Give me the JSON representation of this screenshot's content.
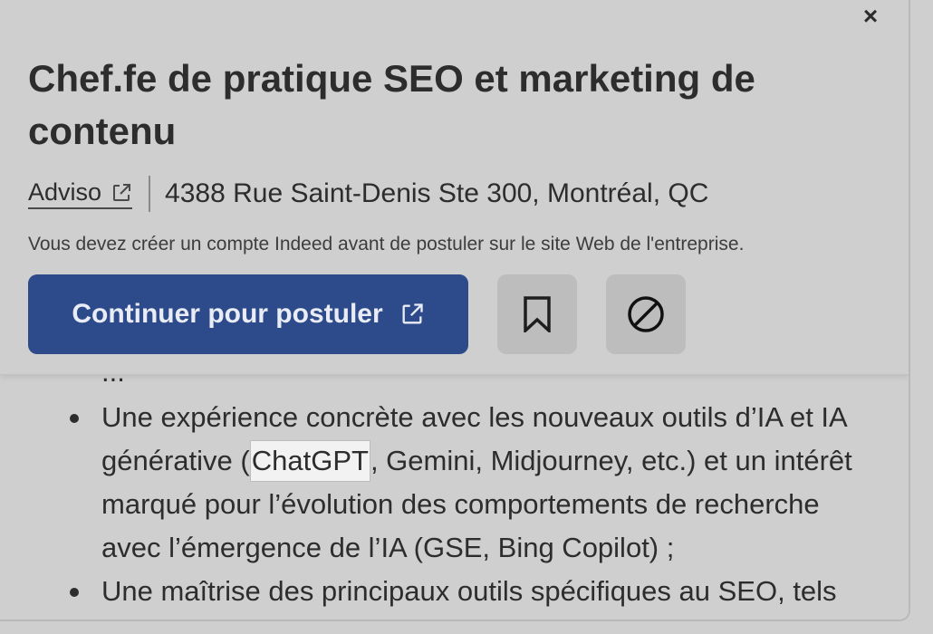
{
  "close_label": "×",
  "job": {
    "title": "Chef.fe de pratique SEO et marketing de contenu",
    "company": "Adviso",
    "location": "4388 Rue Saint-Denis Ste 300, Montréal, QC",
    "notice": "Vous devez créer un compte Indeed avant de postuler sur le site Web de l'entreprise.",
    "apply_label": "Continuer pour postuler"
  },
  "icons": {
    "external": "external-link-icon",
    "save": "bookmark-icon",
    "block": "not-interested-icon",
    "close": "close-icon"
  },
  "colors": {
    "accent": "#2d4a8b",
    "background": "#cfcfcf",
    "text": "#2d2d2d"
  },
  "description": {
    "partial_line": "...",
    "items": [
      {
        "before": "Une expérience concrète avec les nouveaux outils d’IA et IA générative (",
        "highlight": "ChatGPT",
        "after": ", Gemini, Midjourney, etc.) et un intérêt marqué pour l’évolution des comportements de recherche avec l’émergence de l’IA (GSE, Bing Copilot) ;"
      },
      {
        "before": "Une maîtrise des principaux outils spécifiques au SEO, tels",
        "highlight": "",
        "after": ""
      }
    ]
  }
}
